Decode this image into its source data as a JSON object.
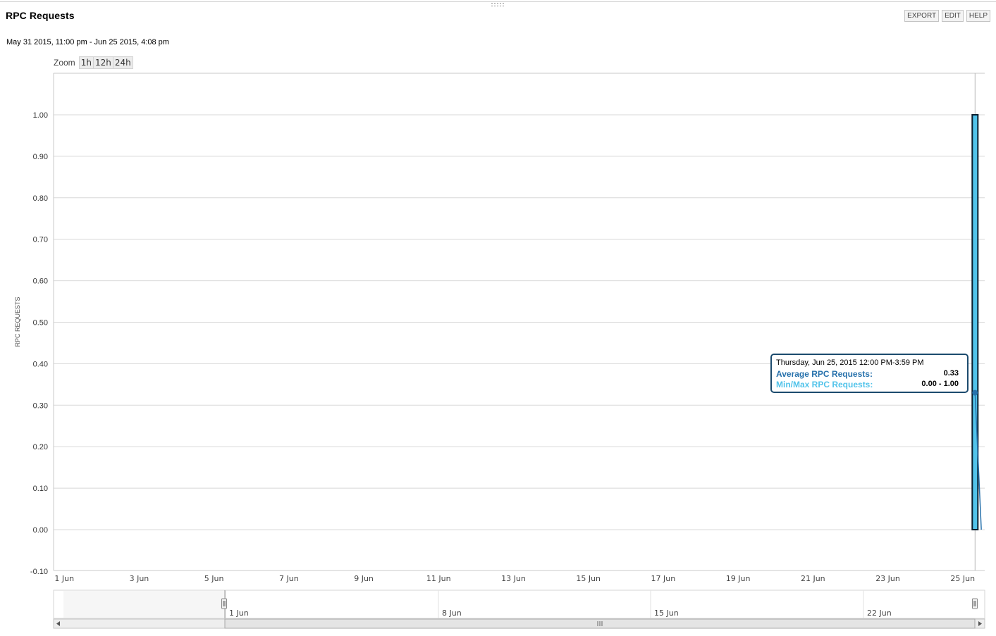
{
  "panel": {
    "title": "RPC Requests",
    "date_range": "May 31 2015, 11:00 pm - Jun 25 2015, 4:08 pm",
    "toolbar": [
      "EXPORT",
      "EDIT",
      "HELP"
    ]
  },
  "zoom": {
    "label": "Zoom",
    "options": [
      "1h",
      "12h",
      "24h"
    ]
  },
  "tooltip": {
    "title": "Thursday, Jun 25, 2015 12:00 PM-3:59 PM",
    "rows": [
      {
        "label": "Average RPC Requests:",
        "value": "0.33"
      },
      {
        "label": "Min/Max RPC Requests:",
        "value": "0.00 - 1.00"
      }
    ]
  },
  "colors": {
    "average": "#2872ac",
    "minmax": "#51c3ea",
    "tooltip_border": "#1c4b6e",
    "grid": "#d8d8d8"
  },
  "chart_data": {
    "type": "bar",
    "ylabel": "RPC REQUESTS",
    "ylim": [
      -0.1,
      1.1
    ],
    "xlim": [
      "2015-05-31 23:00",
      "2015-06-25 20:00"
    ],
    "y_ticks": [
      "1.00",
      "0.90",
      "0.80",
      "0.70",
      "0.60",
      "0.50",
      "0.40",
      "0.30",
      "0.20",
      "0.10",
      "0.00",
      "-0.10"
    ],
    "x_ticks": [
      "1 Jun",
      "3 Jun",
      "5 Jun",
      "7 Jun",
      "9 Jun",
      "11 Jun",
      "13 Jun",
      "15 Jun",
      "17 Jun",
      "19 Jun",
      "21 Jun",
      "23 Jun",
      "25 Jun"
    ],
    "grid": true,
    "series": [
      {
        "name": "Min/Max RPC Requests",
        "type": "range-bar",
        "x": [
          "2015-06-25 12:00"
        ],
        "low": [
          0.0
        ],
        "high": [
          1.0
        ]
      },
      {
        "name": "Average RPC Requests",
        "type": "line",
        "x": [
          "2015-06-25 12:00",
          "2015-06-25 16:00"
        ],
        "values": [
          0.33,
          0.0
        ]
      }
    ],
    "navigator": {
      "x_ticks": [
        "1 Jun",
        "8 Jun",
        "15 Jun",
        "22 Jun"
      ]
    }
  }
}
